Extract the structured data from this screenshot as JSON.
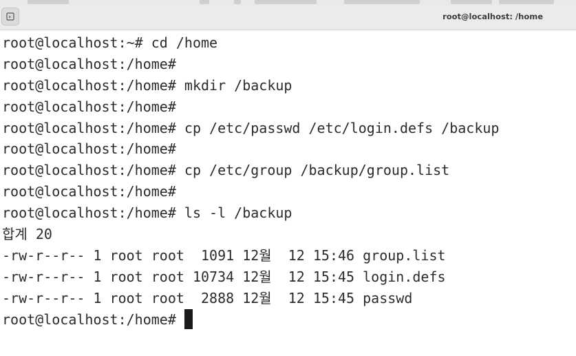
{
  "window": {
    "title": "root@localhost: /home",
    "tab_icon": "terminal-tab-icon"
  },
  "terminal": {
    "lines": [
      "root@localhost:~# cd /home",
      "root@localhost:/home#",
      "root@localhost:/home# mkdir /backup",
      "root@localhost:/home#",
      "root@localhost:/home# cp /etc/passwd /etc/login.defs /backup",
      "root@localhost:/home#",
      "root@localhost:/home# cp /etc/group /backup/group.list",
      "root@localhost:/home#",
      "root@localhost:/home# ls -l /backup",
      "합계 20",
      "-rw-r--r-- 1 root root  1091 12월  12 15:46 group.list",
      "-rw-r--r-- 1 root root 10734 12월  12 15:45 login.defs",
      "-rw-r--r-- 1 root root  2888 12월  12 15:45 passwd"
    ],
    "current_prompt": "root@localhost:/home# "
  }
}
